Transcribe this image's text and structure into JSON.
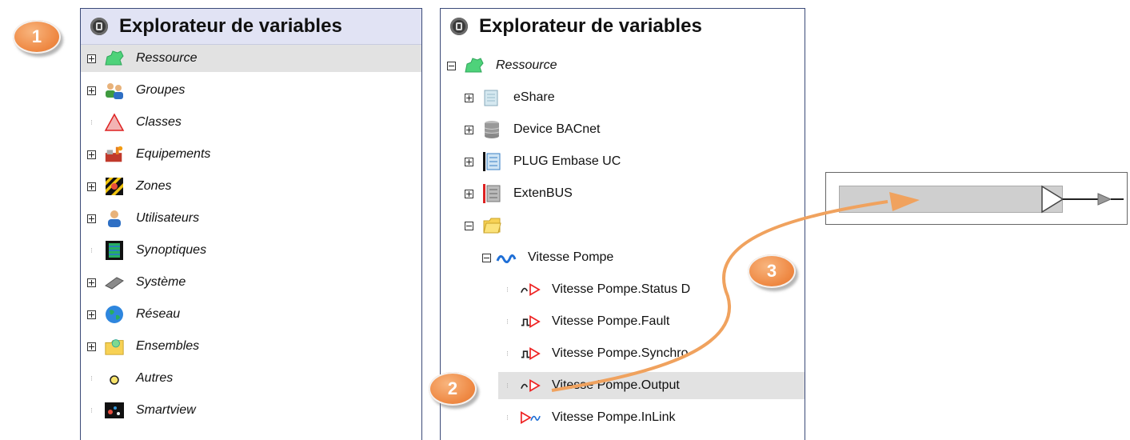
{
  "left_panel": {
    "title": "Explorateur de variables",
    "items": [
      {
        "label": "Ressource",
        "expander": "plus",
        "icon": "resource-icon",
        "selected": true
      },
      {
        "label": "Groupes",
        "expander": "plus",
        "icon": "groups-icon"
      },
      {
        "label": "Classes",
        "expander": "none",
        "icon": "classes-icon"
      },
      {
        "label": "Equipements",
        "expander": "plus",
        "icon": "equipment-icon"
      },
      {
        "label": "Zones",
        "expander": "plus",
        "icon": "zones-icon"
      },
      {
        "label": "Utilisateurs",
        "expander": "plus",
        "icon": "user-icon"
      },
      {
        "label": "Synoptiques",
        "expander": "none",
        "icon": "synoptic-icon"
      },
      {
        "label": "Système",
        "expander": "plus",
        "icon": "system-icon"
      },
      {
        "label": "Réseau",
        "expander": "plus",
        "icon": "globe-icon"
      },
      {
        "label": "Ensembles",
        "expander": "plus",
        "icon": "folder-group-icon"
      },
      {
        "label": "Autres",
        "expander": "none",
        "icon": "circle-icon"
      },
      {
        "label": "Smartview",
        "expander": "none",
        "icon": "smartview-icon"
      }
    ]
  },
  "right_panel": {
    "title": "Explorateur de variables",
    "items": [
      {
        "label": "Ressource",
        "expander": "minus",
        "icon": "resource-icon",
        "italic": true
      },
      {
        "label": "eShare",
        "expander": "plus",
        "icon": "eshare-icon"
      },
      {
        "label": "Device BACnet",
        "expander": "plus",
        "icon": "database-icon"
      },
      {
        "label": "PLUG Embase UC",
        "expander": "plus",
        "icon": "plug-icon"
      },
      {
        "label": "ExtenBUS",
        "expander": "plus",
        "icon": "extenbus-icon"
      },
      {
        "label": "",
        "expander": "minus",
        "icon": "folder-icon"
      },
      {
        "label": "Vitesse Pompe",
        "expander": "minus",
        "icon": "analog-wave-icon"
      },
      {
        "label": "Vitesse Pompe.Status D",
        "expander": "none",
        "icon": "analog-output-icon"
      },
      {
        "label": "Vitesse Pompe.Fault",
        "expander": "none",
        "icon": "digital-output-icon"
      },
      {
        "label": "Vitesse Pompe.Synchro",
        "expander": "none",
        "icon": "digital-output-icon"
      },
      {
        "label": "Vitesse Pompe.Output",
        "expander": "none",
        "icon": "analog-output-icon",
        "selected": true
      },
      {
        "label": "Vitesse Pompe.InLink",
        "expander": "none",
        "icon": "inlink-icon"
      }
    ]
  },
  "badges": {
    "one": "1",
    "two": "2",
    "three": "3"
  },
  "colors": {
    "header_bg": "#e1e3f4",
    "border": "#3b4a78",
    "badge": "#ef8a45",
    "arrow": "#f0a25e",
    "selection": "#e2e2e2"
  }
}
